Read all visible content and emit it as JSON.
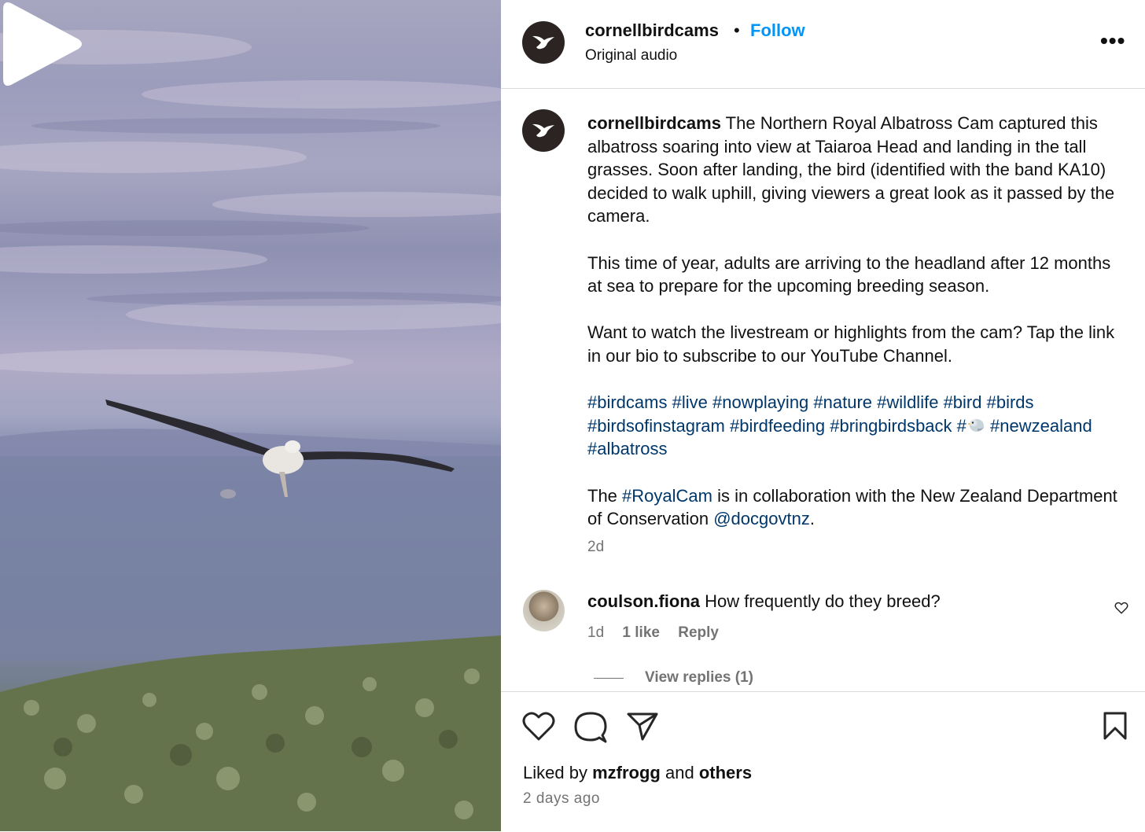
{
  "post": {
    "author": "cornellbirdcams",
    "separator": "•",
    "follow_label": "Follow",
    "audio": "Original audio",
    "more_label": "•••"
  },
  "caption": {
    "author": "cornellbirdcams",
    "p1": "The Northern Royal Albatross Cam captured this albatross soaring into view at Taiaroa Head and landing in the tall grasses. Soon after landing, the bird (identified with the band KA10) decided to walk uphill, giving viewers a great look as it passed by the camera.",
    "p2": "This time of year, adults are arriving to the headland after 12 months at sea to prepare for the upcoming breeding season.",
    "p3": "Want to watch the livestream or highlights from the cam? Tap the link in our bio to subscribe to our YouTube Channel.",
    "hashtags": [
      "#birdcams",
      "#live",
      "#nowplaying",
      "#nature",
      "#wildlife",
      "#bird",
      "#birds",
      "#birdsofinstagram",
      "#birdfeeding",
      "#bringbirdsback",
      "#",
      "#newzealand",
      "#albatross"
    ],
    "p5_before": "The ",
    "p5_tag": "#RoyalCam",
    "p5_middle": " is in collaboration with the New Zealand Department of Conservation ",
    "p5_mention": "@docgovtnz",
    "p5_after": ".",
    "time": "2d"
  },
  "comment": {
    "author": "coulson.fiona",
    "text": "How frequently do they breed?",
    "time": "1d",
    "likes": "1 like",
    "reply": "Reply",
    "view_replies": "View replies (1)"
  },
  "footer": {
    "liked_by_prefix": "Liked by",
    "liked_by_user": "mzfrogg",
    "liked_by_and": "and",
    "liked_by_others": "others",
    "posted_ago": "2 days ago"
  },
  "icons": {
    "like": "heart-icon",
    "comment": "comment-icon",
    "share": "paper-plane-icon",
    "save": "bookmark-icon",
    "play": "play-icon",
    "logo": "hummingbird-icon",
    "comment_like": "heart-outline-icon",
    "emoji": "bird-emoji"
  },
  "colors": {
    "link_blue": "#0095f6",
    "hashtag_blue": "#00376b",
    "muted_gray": "#737373",
    "avatar_dark": "#2b2422"
  }
}
